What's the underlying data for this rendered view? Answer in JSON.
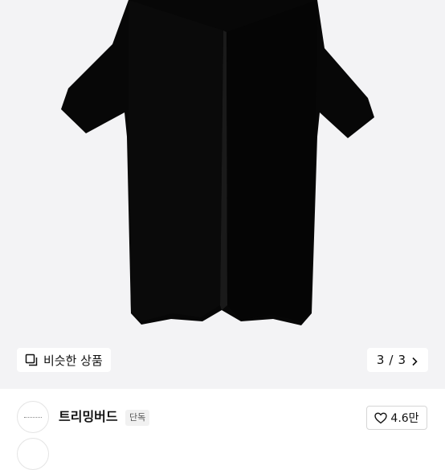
{
  "gallery": {
    "similar_label": "비슷한 상품",
    "current_page": "3",
    "separator": "/",
    "total_pages": "3"
  },
  "shop": {
    "name": "트리밍버드",
    "badge": "단독",
    "like_count": "4.6만"
  },
  "icons": {
    "similar": "similar-products-icon",
    "next": "chevron-right-icon",
    "like": "heart-outline-icon"
  },
  "colors": {
    "image_background": "#f3f3f5",
    "garment": "#070707"
  }
}
